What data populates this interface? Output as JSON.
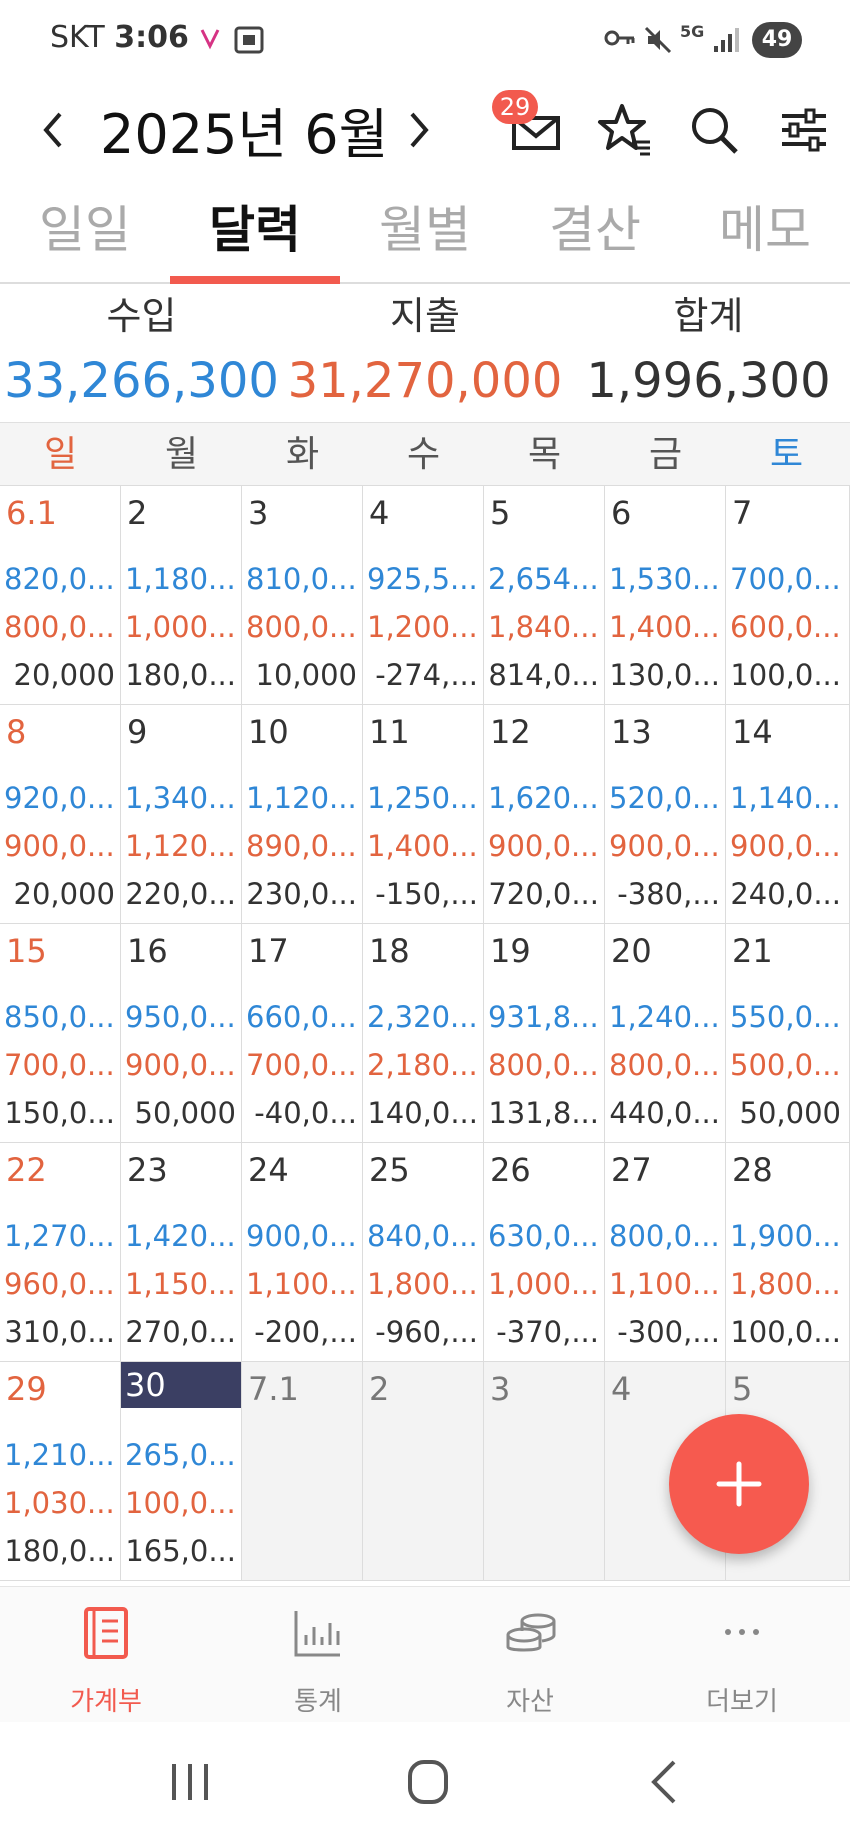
{
  "status": {
    "carrier": "SKT",
    "time": "3:06",
    "battery": "49",
    "network": "5G"
  },
  "header": {
    "month": "2025년 6월",
    "mail_count": "29"
  },
  "tabs": [
    {
      "label": "일일"
    },
    {
      "label": "달력"
    },
    {
      "label": "월별"
    },
    {
      "label": "결산"
    },
    {
      "label": "메모"
    }
  ],
  "summary": {
    "income_label": "수입",
    "income": "33,266,300",
    "expense_label": "지출",
    "expense": "31,270,000",
    "total_label": "합계",
    "total": "1,996,300"
  },
  "weekdays": [
    "일",
    "월",
    "화",
    "수",
    "목",
    "금",
    "토"
  ],
  "days": [
    {
      "d": "6.1",
      "inc": "820,0...",
      "exp": "800,0...",
      "tot": "20,000"
    },
    {
      "d": "2",
      "inc": "1,180...",
      "exp": "1,000...",
      "tot": "180,0..."
    },
    {
      "d": "3",
      "inc": "810,0...",
      "exp": "800,0...",
      "tot": "10,000"
    },
    {
      "d": "4",
      "inc": "925,5...",
      "exp": "1,200...",
      "tot": "-274,..."
    },
    {
      "d": "5",
      "inc": "2,654...",
      "exp": "1,840...",
      "tot": "814,0..."
    },
    {
      "d": "6",
      "inc": "1,530...",
      "exp": "1,400...",
      "tot": "130,0..."
    },
    {
      "d": "7",
      "inc": "700,0...",
      "exp": "600,0...",
      "tot": "100,0..."
    },
    {
      "d": "8",
      "inc": "920,0...",
      "exp": "900,0...",
      "tot": "20,000"
    },
    {
      "d": "9",
      "inc": "1,340...",
      "exp": "1,120...",
      "tot": "220,0..."
    },
    {
      "d": "10",
      "inc": "1,120...",
      "exp": "890,0...",
      "tot": "230,0..."
    },
    {
      "d": "11",
      "inc": "1,250...",
      "exp": "1,400...",
      "tot": "-150,..."
    },
    {
      "d": "12",
      "inc": "1,620...",
      "exp": "900,0...",
      "tot": "720,0..."
    },
    {
      "d": "13",
      "inc": "520,0...",
      "exp": "900,0...",
      "tot": "-380,..."
    },
    {
      "d": "14",
      "inc": "1,140...",
      "exp": "900,0...",
      "tot": "240,0..."
    },
    {
      "d": "15",
      "inc": "850,0...",
      "exp": "700,0...",
      "tot": "150,0..."
    },
    {
      "d": "16",
      "inc": "950,0...",
      "exp": "900,0...",
      "tot": "50,000"
    },
    {
      "d": "17",
      "inc": "660,0...",
      "exp": "700,0...",
      "tot": "-40,0..."
    },
    {
      "d": "18",
      "inc": "2,320...",
      "exp": "2,180...",
      "tot": "140,0..."
    },
    {
      "d": "19",
      "inc": "931,8...",
      "exp": "800,0...",
      "tot": "131,8..."
    },
    {
      "d": "20",
      "inc": "1,240...",
      "exp": "800,0...",
      "tot": "440,0..."
    },
    {
      "d": "21",
      "inc": "550,0...",
      "exp": "500,0...",
      "tot": "50,000"
    },
    {
      "d": "22",
      "inc": "1,270...",
      "exp": "960,0...",
      "tot": "310,0..."
    },
    {
      "d": "23",
      "inc": "1,420...",
      "exp": "1,150...",
      "tot": "270,0..."
    },
    {
      "d": "24",
      "inc": "900,0...",
      "exp": "1,100...",
      "tot": "-200,..."
    },
    {
      "d": "25",
      "inc": "840,0...",
      "exp": "1,800...",
      "tot": "-960,..."
    },
    {
      "d": "26",
      "inc": "630,0...",
      "exp": "1,000...",
      "tot": "-370,..."
    },
    {
      "d": "27",
      "inc": "800,0...",
      "exp": "1,100...",
      "tot": "-300,..."
    },
    {
      "d": "28",
      "inc": "1,900...",
      "exp": "1,800...",
      "tot": "100,0..."
    },
    {
      "d": "29",
      "inc": "1,210...",
      "exp": "1,030...",
      "tot": "180,0..."
    },
    {
      "d": "30",
      "inc": "265,0...",
      "exp": "100,0...",
      "tot": "165,0...",
      "today": true
    },
    {
      "d": "7.1",
      "other": true
    },
    {
      "d": "2",
      "other": true
    },
    {
      "d": "3",
      "other": true
    },
    {
      "d": "4",
      "other": true
    },
    {
      "d": "5",
      "other": true
    }
  ],
  "bottom_nav": [
    {
      "label": "가계부",
      "icon": "book-icon"
    },
    {
      "label": "통계",
      "icon": "bar-chart-icon"
    },
    {
      "label": "자산",
      "icon": "coins-icon"
    },
    {
      "label": "더보기",
      "icon": "more-icon"
    }
  ],
  "colors": {
    "accent": "#f25a4e",
    "income": "#2f87d6",
    "expense": "#e2643f",
    "sunday": "#e2643f",
    "saturday": "#2f87d6",
    "today_bg": "#3b3f63"
  }
}
